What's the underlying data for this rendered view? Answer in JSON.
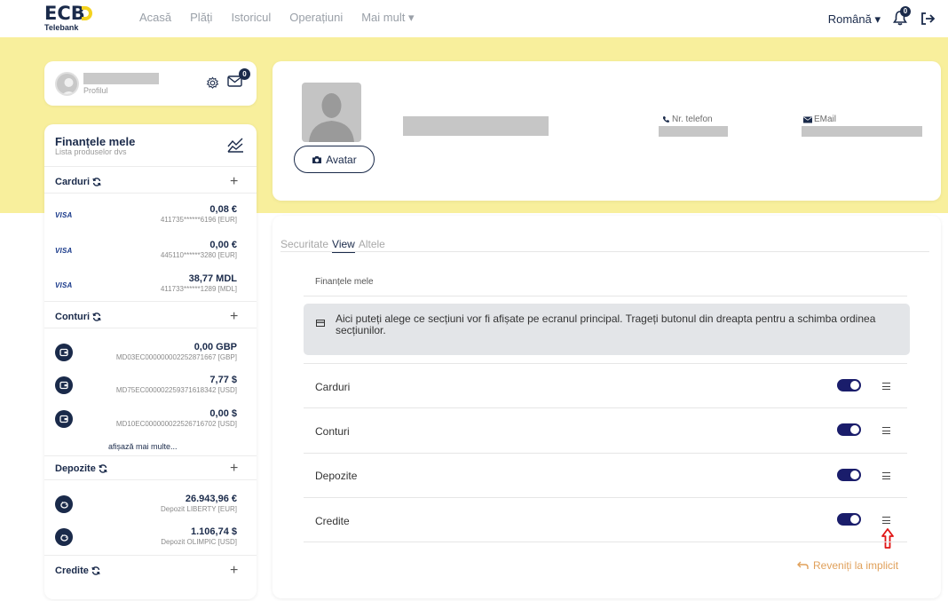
{
  "brand": {
    "name": "ECB",
    "sub": "Telebank",
    "accent": "#f4d21f",
    "primary": "#1a2a4a"
  },
  "nav": {
    "links": [
      "Acasă",
      "Plăți",
      "Istoricul",
      "Operațiuni",
      "Mai mult ▾"
    ],
    "language": "Română ▾",
    "bell_badge": "0",
    "logout_icon": "logout-icon"
  },
  "profile": {
    "label": "Profilul",
    "mail_badge": "0"
  },
  "finances": {
    "title": "Finanțele mele",
    "subtitle": "Lista produselor dvs",
    "sections": {
      "cards": {
        "title": "Carduri",
        "items": [
          {
            "brand": "VISA",
            "amount": "0,08  €",
            "number": "411735******6196 [EUR]"
          },
          {
            "brand": "VISA",
            "amount": "0,00  €",
            "number": "445110******3280 [EUR]"
          },
          {
            "brand": "VISA",
            "amount": "38,77  MDL",
            "number": "411733******1289 [MDL]"
          }
        ]
      },
      "accounts": {
        "title": "Conturi",
        "items": [
          {
            "amount": "0,00  GBP",
            "number": "MD03EC000000002252871667 [GBP]"
          },
          {
            "amount": "7,77  $",
            "number": "MD75EC000002259371618342 [USD]"
          },
          {
            "amount": "0,00  $",
            "number": "MD10EC000000022526716702 [USD]"
          }
        ],
        "more": "afișază mai multe..."
      },
      "deposits": {
        "title": "Depozite",
        "items": [
          {
            "amount": "26.943,96  €",
            "number": "Depozit LIBERTY [EUR]"
          },
          {
            "amount": "1.106,74  $",
            "number": "Depozit OLIMPIC [USD]"
          }
        ]
      },
      "credits": {
        "title": "Credite"
      }
    }
  },
  "header": {
    "avatar_button": "Avatar",
    "phone_label": "Nr. telefon",
    "email_label": "EMail"
  },
  "settings": {
    "tabs": [
      "Securitate",
      "View",
      "Altele"
    ],
    "active_tab": "View",
    "section_title": "Finanțele mele",
    "info": "Aici puteți alege ce secțiuni vor fi afișate pe ecranul principal. Trageți butonul din dreapta pentru a schimba ordinea secțiunilor.",
    "rows": [
      {
        "label": "Carduri",
        "enabled": true
      },
      {
        "label": "Conturi",
        "enabled": true
      },
      {
        "label": "Depozite",
        "enabled": true
      },
      {
        "label": "Credite",
        "enabled": true
      }
    ],
    "reset": "Reveniți la implicit",
    "toggle_color": "#1a1d6b",
    "reset_color": "#e0a05a"
  }
}
